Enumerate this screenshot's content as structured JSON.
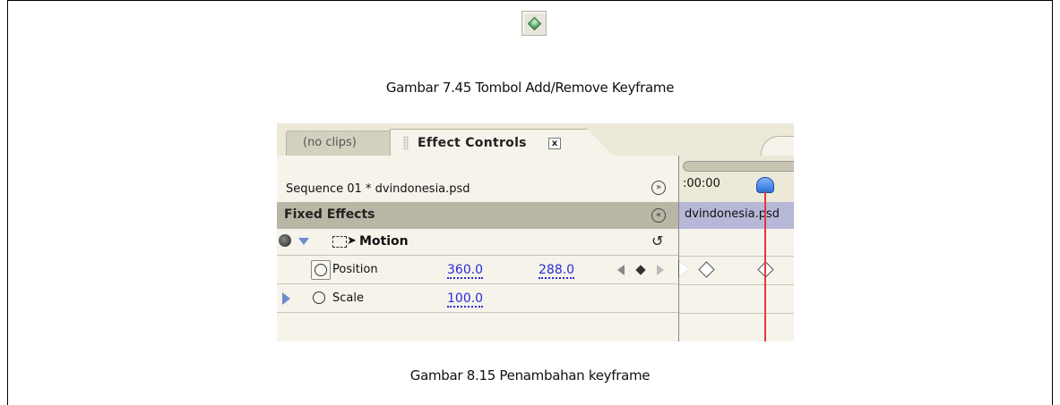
{
  "captions": {
    "top": "Gambar 7.45 Tombol Add/Remove Keyframe",
    "bottom": "Gambar 8.15 Penambahan keyframe"
  },
  "keyframe_button": {
    "icon": "green-diamond-keyframe-icon"
  },
  "panel": {
    "tabs": [
      {
        "label": "(no clips)",
        "active": false
      },
      {
        "label": "Effect Controls",
        "active": true,
        "close_symbol": "x"
      }
    ],
    "sequence_label": "Sequence 01 * dvindonesia.psd",
    "fixed_effects_label": "Fixed Effects",
    "motion": {
      "label": "Motion"
    },
    "properties": [
      {
        "label": "Position",
        "value_x": "360.0",
        "value_y": "288.0"
      },
      {
        "label": "Scale",
        "value": "100.0"
      }
    ],
    "timeline": {
      "time": ":00:00",
      "clip_label": "dvindonesia.psd"
    },
    "colors": {
      "accent_blue": "#2a2adb",
      "playhead_red": "#e03a3a",
      "header_gray": "#b9b6a6",
      "clip_purple": "#b7b7d8"
    }
  }
}
